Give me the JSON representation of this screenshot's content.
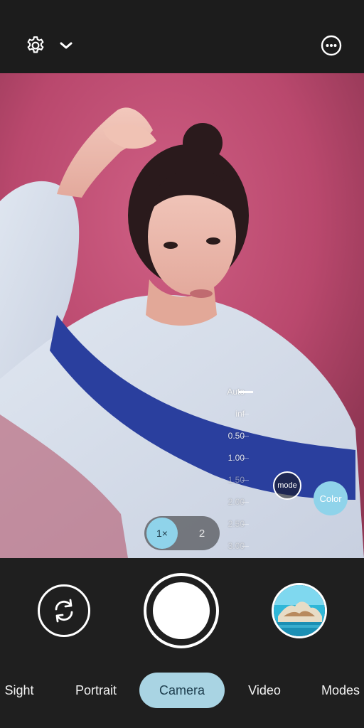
{
  "top_bar": {
    "settings_icon": "gear-icon",
    "dropdown_icon": "chevron-down-icon",
    "more_icon": "more-options-icon"
  },
  "focus_scale": {
    "labels": [
      "Auto",
      "inf",
      "0.50",
      "1.00",
      "1.50",
      "2.00",
      "2.50",
      "3.00"
    ],
    "active_index": 0
  },
  "overlay": {
    "mode_label": "mode",
    "color_label": "Color"
  },
  "zoom": {
    "options": [
      "1×",
      "2"
    ],
    "active": "1×"
  },
  "controls": {
    "flip_icon": "flip-camera-icon",
    "shutter_icon": "shutter-icon",
    "thumbnail": "last-photo-thumbnail"
  },
  "modes": {
    "tabs": [
      "Sight",
      "Portrait",
      "Camera",
      "Video",
      "Modes"
    ],
    "active": "Camera"
  },
  "colors": {
    "accent": "#8fd3ea",
    "active_tab": "#a9d4e3",
    "background": "#1f1f1f"
  }
}
